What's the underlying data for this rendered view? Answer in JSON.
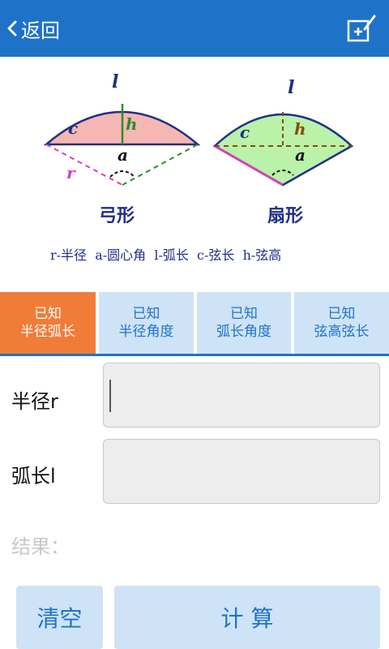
{
  "header": {
    "back_label": "返回",
    "back_icon": "chevron-left-icon",
    "edit_icon": "edit-note-icon",
    "bar_color": "#1E73C8"
  },
  "diagram": {
    "segment": {
      "arc_label": "l",
      "chord_label": "c",
      "height_label": "h",
      "angle_label": "a",
      "radius_label": "r",
      "caption": "弓形"
    },
    "sector": {
      "arc_label": "l",
      "chord_label": "c",
      "height_label": "h",
      "angle_label": "a",
      "caption": "扇形"
    },
    "legend": "r-半径  a-圆心角  l-弧长  c-弦长  h-弦高",
    "colors": {
      "segment_fill": "#F6B6B3",
      "sector_fill": "#B9F2A8",
      "outline": "#1F2F86",
      "height_line": "#2E8B2E",
      "radius_line": "#D43FBE"
    }
  },
  "tabs": [
    {
      "line1": "已知",
      "line2": "半径弧长",
      "active": true
    },
    {
      "line1": "已知",
      "line2": "半径角度",
      "active": false
    },
    {
      "line1": "已知",
      "line2": "弧长角度",
      "active": false
    },
    {
      "line1": "已知",
      "line2": "弦高弦长",
      "active": false
    }
  ],
  "form": {
    "radius_label": "半径r",
    "radius_value": "",
    "arc_label": "弧长l",
    "arc_value": "",
    "result_label": "结果："
  },
  "buttons": {
    "clear_label": "清空",
    "calculate_label": "计 算"
  }
}
